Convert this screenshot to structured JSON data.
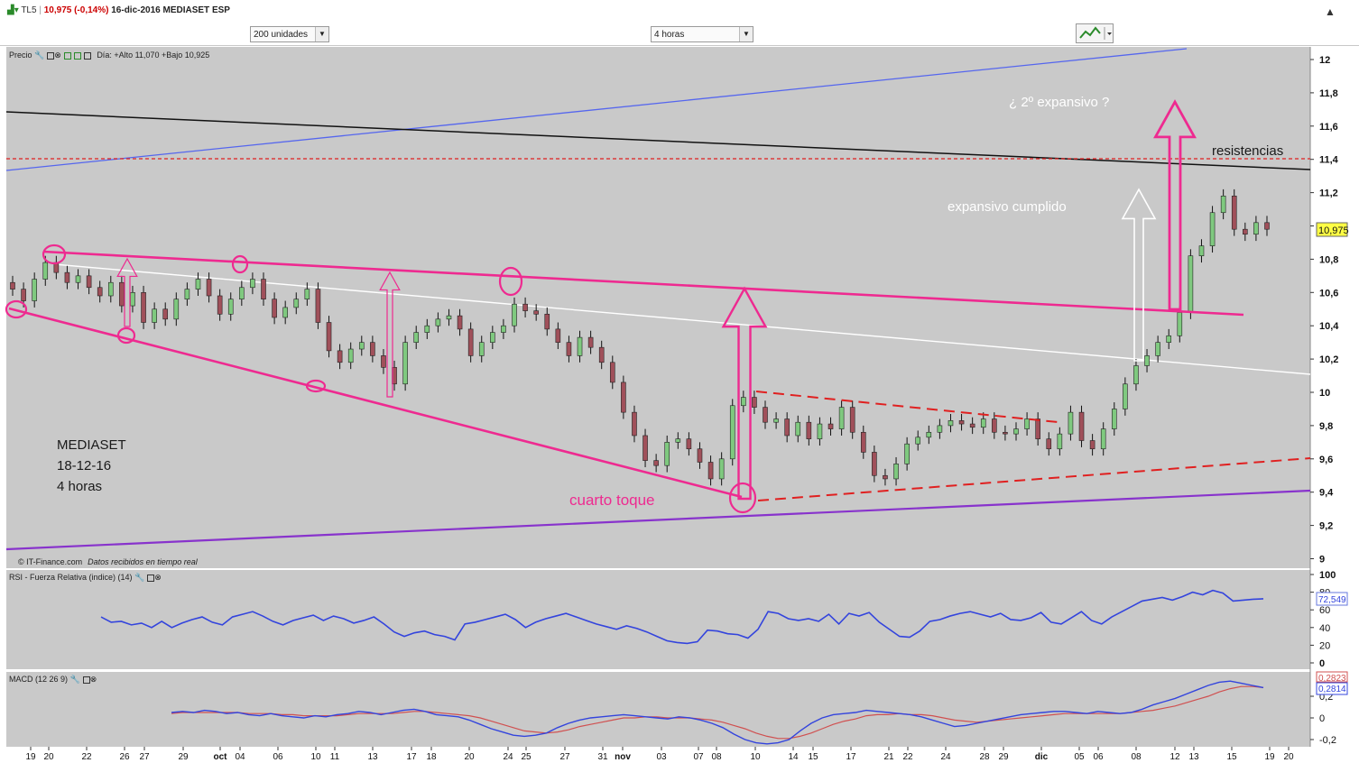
{
  "header": {
    "symbol": "TL5",
    "price_change": "10,975 (-0,14%)",
    "date_name": "16-dic-2016 MEDIASET ESP",
    "units_select": "200 unidades",
    "period_select": "4 horas"
  },
  "price_panel": {
    "label": "Precio",
    "day_info": "Día: +Alto 11,070 +Bajo 10,925",
    "credit": "© IT-Finance.com",
    "credit_note": "Datos recibidos en tiempo real",
    "last_price_tag": "10,975"
  },
  "rsi_panel": {
    "label": "RSI - Fuerza Relativa (indice) (14)",
    "value_tag": "72,549"
  },
  "macd_panel": {
    "label": "MACD (12 26 9)",
    "value_tag_1": "0,2823",
    "value_tag_2": "0,2814"
  },
  "annotations": {
    "company": "MEDIASET",
    "date": "18-12-16",
    "timeframe": "4 horas",
    "cuarto_toque": "cuarto toque",
    "segundo_expansivo": "¿ 2º  expansivo ?",
    "resistencias": "resistencias",
    "expansivo_cumplido": "expansivo cumplido"
  },
  "colors": {
    "chart_bg": "#c9c9c9",
    "up_candle": "#7fc97f",
    "down_candle": "#a0505a",
    "pink": "#ee2a90",
    "blue_line": "#5566ee",
    "purple_line": "#8833cc",
    "red_dashed": "#e02020",
    "rsi_line": "#3344dd",
    "macd_line": "#3344dd",
    "signal_line": "#d05050"
  },
  "chart_data": {
    "type": "line",
    "price_axis": {
      "ylim": [
        8.92,
        12.12
      ],
      "ticks": [
        "12",
        "11,8",
        "11,6",
        "11,4",
        "11,2",
        "11",
        "10,8",
        "10,6",
        "10,4",
        "10,2",
        "10",
        "9,8",
        "9,6",
        "9,4",
        "9,2",
        "9"
      ]
    },
    "x_ticks": [
      "19",
      "20",
      "22",
      "26",
      "27",
      "29",
      "oct",
      "04",
      "06",
      "10",
      "11",
      "13",
      "17",
      "18",
      "20",
      "24",
      "25",
      "27",
      "31",
      "nov",
      "03",
      "07",
      "08",
      "10",
      "14",
      "15",
      "17",
      "21",
      "22",
      "24",
      "28",
      "29",
      "dic",
      "05",
      "06",
      "08",
      "12",
      "13",
      "15",
      "19",
      "20"
    ],
    "price_series": [
      10.62,
      10.55,
      10.68,
      10.78,
      10.72,
      10.66,
      10.7,
      10.63,
      10.58,
      10.66,
      10.52,
      10.6,
      10.42,
      10.5,
      10.44,
      10.56,
      10.62,
      10.68,
      10.58,
      10.47,
      10.56,
      10.63,
      10.68,
      10.56,
      10.45,
      10.51,
      10.56,
      10.62,
      10.42,
      10.25,
      10.18,
      10.26,
      10.3,
      10.22,
      10.15,
      10.05,
      10.3,
      10.36,
      10.4,
      10.44,
      10.46,
      10.38,
      10.22,
      10.3,
      10.36,
      10.4,
      10.53,
      10.49,
      10.47,
      10.38,
      10.3,
      10.22,
      10.33,
      10.27,
      10.18,
      10.06,
      9.88,
      9.74,
      9.59,
      9.56,
      9.7,
      9.72,
      9.66,
      9.58,
      9.48,
      9.6,
      9.92,
      9.97,
      9.91,
      9.82,
      9.84,
      9.74,
      9.82,
      9.72,
      9.81,
      9.78,
      9.91,
      9.76,
      9.64,
      9.5,
      9.48,
      9.57,
      9.69,
      9.73,
      9.76,
      9.8,
      9.83,
      9.81,
      9.79,
      9.84,
      9.76,
      9.75,
      9.78,
      9.84,
      9.72,
      9.66,
      9.75,
      9.88,
      9.71,
      9.66,
      9.78,
      9.9,
      10.05,
      10.16,
      10.22,
      10.3,
      10.34,
      10.48,
      10.82,
      10.88,
      11.08,
      11.18,
      10.98,
      10.95,
      11.02,
      10.98
    ],
    "rsi_series": [
      52,
      46,
      47,
      43,
      45,
      40,
      47,
      40,
      45,
      49,
      52,
      46,
      43,
      52,
      55,
      58,
      53,
      47,
      43,
      48,
      51,
      54,
      48,
      53,
      50,
      45,
      48,
      52,
      44,
      35,
      30,
      34,
      36,
      32,
      30,
      26,
      44,
      46,
      49,
      52,
      55,
      49,
      40,
      46,
      50,
      53,
      56,
      52,
      48,
      44,
      41,
      38,
      42,
      39,
      35,
      30,
      25,
      23,
      22,
      24,
      37,
      36,
      33,
      32,
      28,
      38,
      58,
      56,
      50,
      48,
      50,
      47,
      55,
      44,
      56,
      53,
      57,
      46,
      38,
      30,
      29,
      36,
      47,
      49,
      53,
      56,
      58,
      55,
      52,
      56,
      49,
      48,
      51,
      57,
      46,
      44,
      51,
      58,
      48,
      44,
      52,
      58,
      64,
      70,
      72,
      74,
      71,
      75,
      80,
      77,
      82,
      79,
      70,
      71,
      72,
      72.5
    ],
    "rsi_axis": {
      "ylim": [
        0,
        100
      ],
      "ticks": [
        "100",
        "80",
        "60",
        "40",
        "20",
        "0"
      ]
    },
    "macd_series": [
      0.05,
      0.06,
      0.05,
      0.07,
      0.06,
      0.04,
      0.05,
      0.03,
      0.02,
      0.04,
      0.02,
      0.01,
      0.0,
      0.02,
      0.01,
      0.03,
      0.04,
      0.06,
      0.05,
      0.03,
      0.05,
      0.07,
      0.08,
      0.06,
      0.03,
      0.02,
      0.01,
      -0.02,
      -0.06,
      -0.1,
      -0.13,
      -0.16,
      -0.17,
      -0.16,
      -0.14,
      -0.09,
      -0.05,
      -0.02,
      0.0,
      0.01,
      0.02,
      0.03,
      0.02,
      0.01,
      0.0,
      -0.01,
      0.01,
      0.0,
      -0.02,
      -0.05,
      -0.09,
      -0.15,
      -0.2,
      -0.23,
      -0.24,
      -0.23,
      -0.2,
      -0.12,
      -0.05,
      0.0,
      0.03,
      0.04,
      0.05,
      0.07,
      0.06,
      0.05,
      0.04,
      0.03,
      0.01,
      -0.02,
      -0.05,
      -0.08,
      -0.07,
      -0.05,
      -0.03,
      -0.01,
      0.01,
      0.03,
      0.04,
      0.05,
      0.06,
      0.06,
      0.05,
      0.04,
      0.06,
      0.05,
      0.04,
      0.05,
      0.08,
      0.12,
      0.15,
      0.18,
      0.22,
      0.26,
      0.3,
      0.33,
      0.34,
      0.32,
      0.3,
      0.28
    ],
    "signal_series": [
      0.04,
      0.05,
      0.05,
      0.05,
      0.05,
      0.05,
      0.05,
      0.04,
      0.04,
      0.04,
      0.03,
      0.03,
      0.02,
      0.02,
      0.02,
      0.02,
      0.03,
      0.04,
      0.04,
      0.04,
      0.04,
      0.05,
      0.06,
      0.06,
      0.05,
      0.04,
      0.03,
      0.02,
      0.0,
      -0.03,
      -0.06,
      -0.09,
      -0.12,
      -0.13,
      -0.14,
      -0.13,
      -0.11,
      -0.08,
      -0.06,
      -0.04,
      -0.02,
      0.0,
      0.0,
      0.01,
      0.01,
      0.0,
      0.0,
      0.0,
      -0.01,
      -0.02,
      -0.04,
      -0.07,
      -0.1,
      -0.14,
      -0.17,
      -0.19,
      -0.19,
      -0.17,
      -0.14,
      -0.1,
      -0.06,
      -0.03,
      -0.01,
      0.02,
      0.03,
      0.03,
      0.04,
      0.03,
      0.03,
      0.02,
      0.0,
      -0.02,
      -0.03,
      -0.04,
      -0.03,
      -0.02,
      -0.01,
      0.0,
      0.01,
      0.02,
      0.03,
      0.04,
      0.04,
      0.04,
      0.04,
      0.04,
      0.04,
      0.05,
      0.06,
      0.07,
      0.09,
      0.11,
      0.14,
      0.17,
      0.2,
      0.24,
      0.27,
      0.29,
      0.29,
      0.28
    ],
    "macd_axis": {
      "ylim": [
        -0.24,
        0.34
      ],
      "ticks": [
        "0,2",
        "0",
        "-0,2"
      ]
    }
  }
}
